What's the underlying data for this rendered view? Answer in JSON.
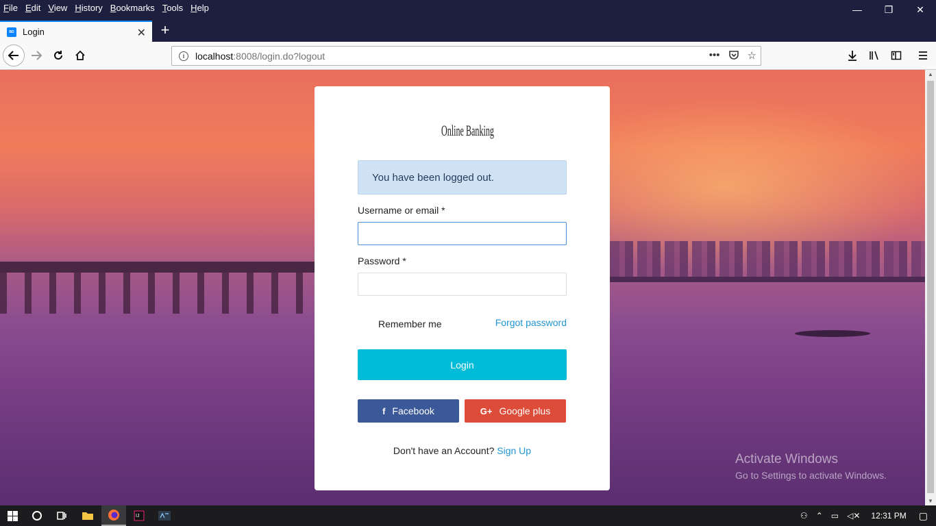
{
  "browser": {
    "menu": [
      "File",
      "Edit",
      "View",
      "History",
      "Bookmarks",
      "Tools",
      "Help"
    ],
    "window_controls": {
      "minimize": "—",
      "restore": "❐",
      "close": "✕"
    },
    "tab": {
      "title": "Login",
      "favicon": "BD",
      "close": "✕"
    },
    "new_tab": "+",
    "url": {
      "host": "localhost",
      "path": ":8008/login.do?logout"
    },
    "icons": [
      "back-icon",
      "forward-icon",
      "reload-icon",
      "home-icon",
      "info-icon",
      "page-actions-icon",
      "pocket-icon",
      "bookmark-star-icon",
      "downloads-icon",
      "library-icon",
      "sidebar-icon",
      "menu-icon"
    ]
  },
  "login": {
    "logo_text": "Online Banking",
    "alert": "You have been logged out.",
    "username_label": "Username or email *",
    "password_label": "Password *",
    "remember_label": "Remember me",
    "forgot_link": "Forgot password",
    "login_button": "Login",
    "facebook_button": "Facebook",
    "google_button": "Google plus",
    "no_account_text": "Don't have an Account?",
    "signup_link": "Sign Up"
  },
  "watermark": {
    "title": "Activate Windows",
    "subtitle": "Go to Settings to activate Windows."
  },
  "taskbar": {
    "time": "12:31 PM",
    "apps": [
      "start-icon",
      "cortana-icon",
      "task-view-icon",
      "file-explorer-icon",
      "firefox-icon",
      "intellij-icon",
      "mysql-icon"
    ]
  }
}
